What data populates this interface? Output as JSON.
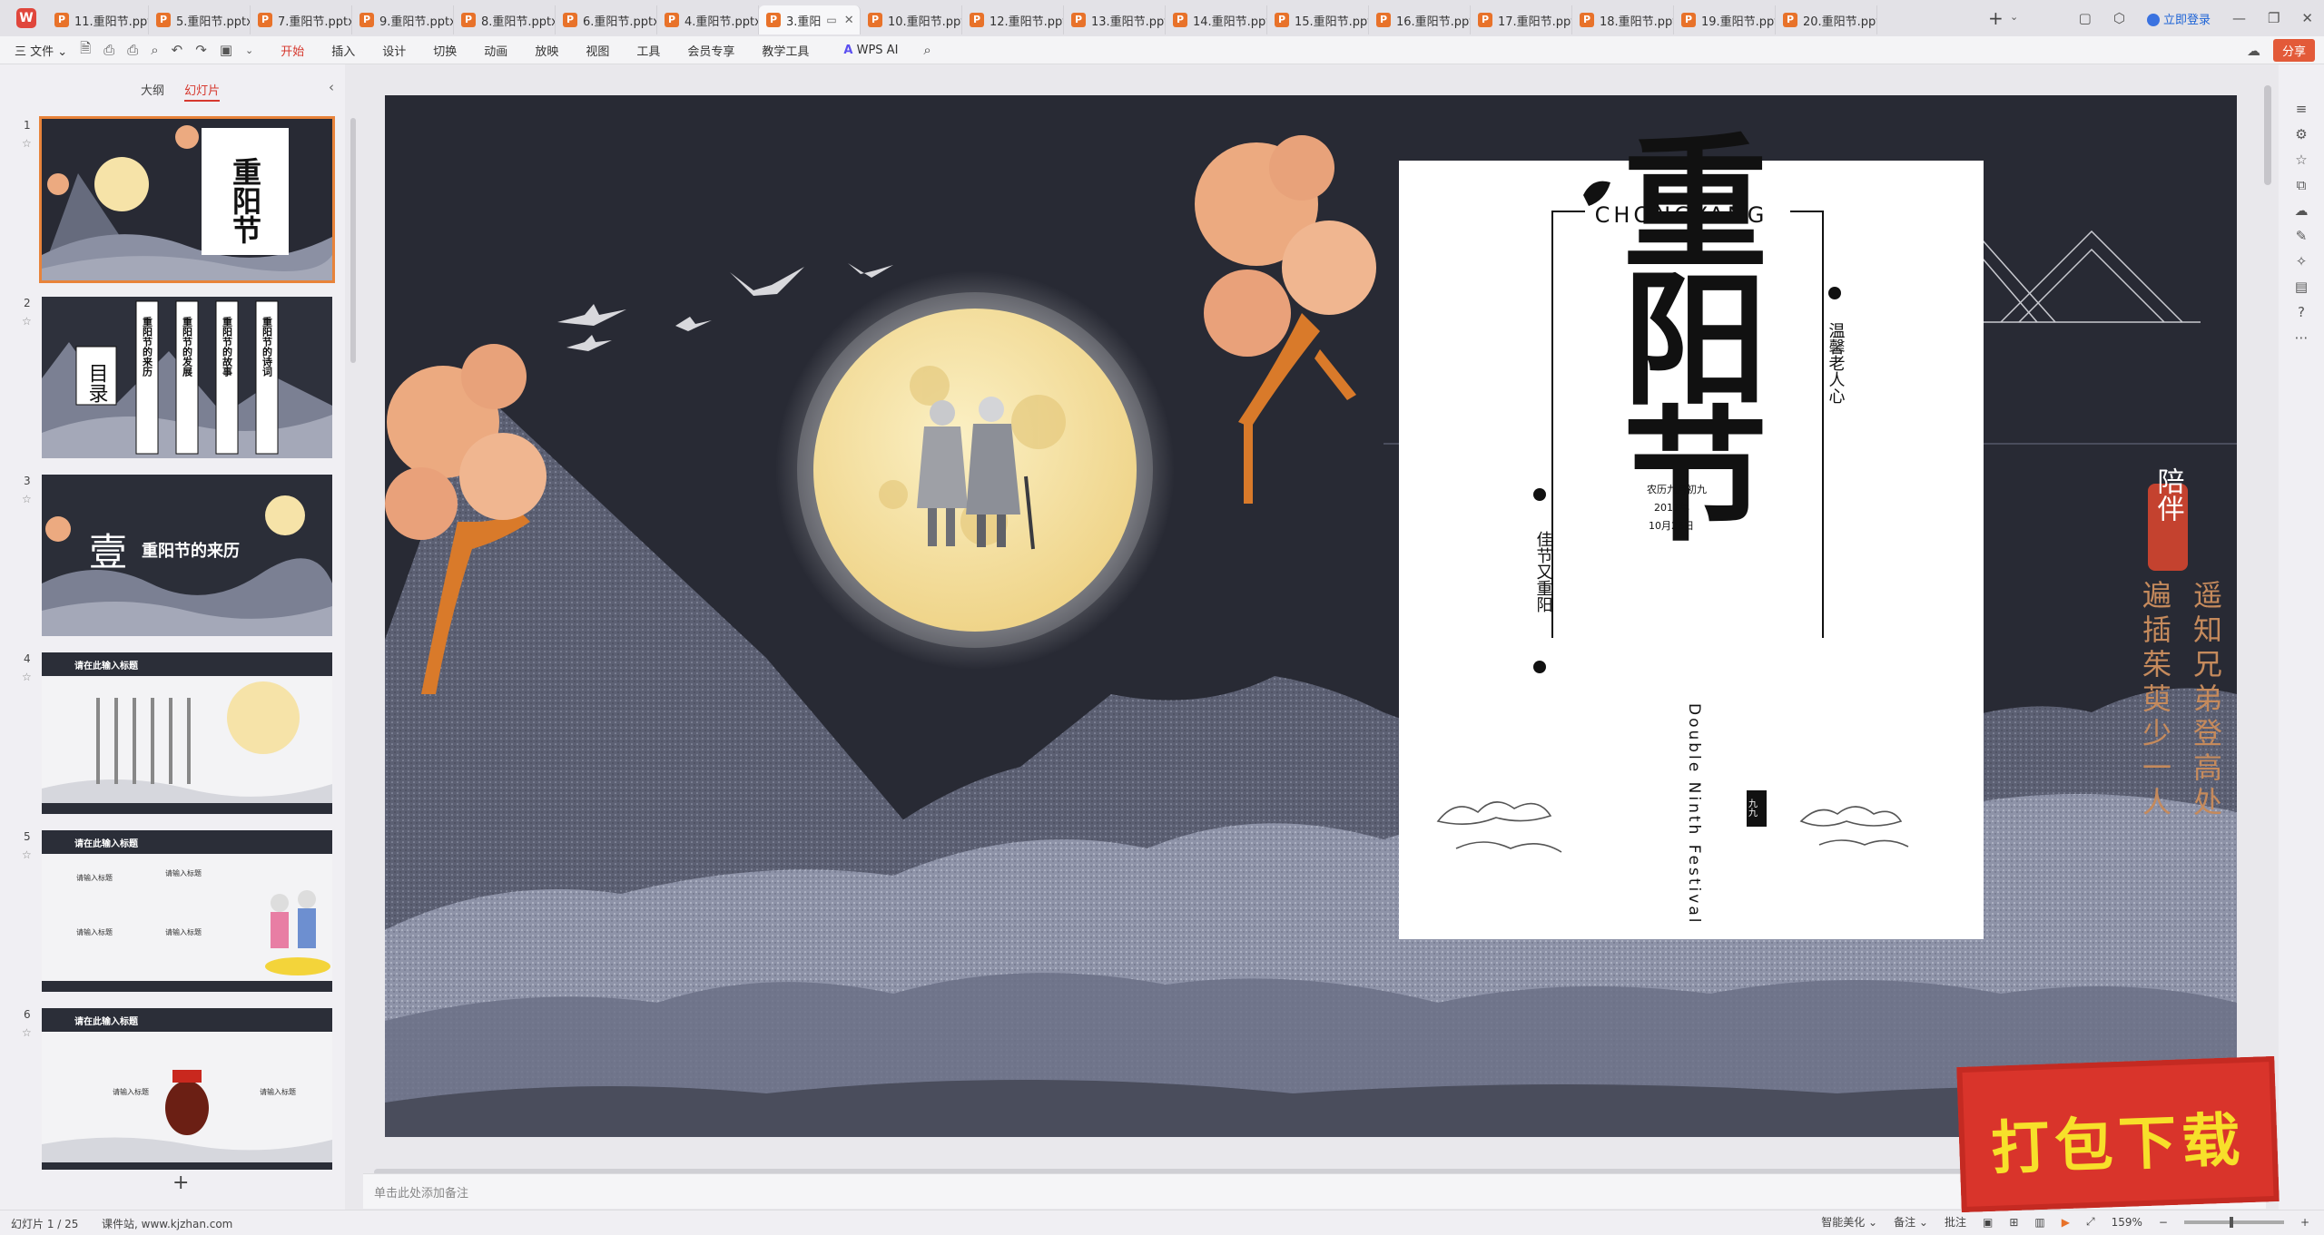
{
  "app": {
    "logo": "W"
  },
  "tabs": [
    {
      "label": "11.重阳节.ppt"
    },
    {
      "label": "5.重阳节.pptx"
    },
    {
      "label": "7.重阳节.pptx"
    },
    {
      "label": "9.重阳节.pptx"
    },
    {
      "label": "8.重阳节.pptx"
    },
    {
      "label": "6.重阳节.pptx"
    },
    {
      "label": "4.重阳节.pptx"
    },
    {
      "label": "3.重阳",
      "active": true
    },
    {
      "label": "10.重阳节.ppt"
    },
    {
      "label": "12.重阳节.ppt"
    },
    {
      "label": "13.重阳节.ppt"
    },
    {
      "label": "14.重阳节.ppt"
    },
    {
      "label": "15.重阳节.ppt"
    },
    {
      "label": "16.重阳节.ppt"
    },
    {
      "label": "17.重阳节.ppt"
    },
    {
      "label": "18.重阳节.ppt"
    },
    {
      "label": "19.重阳节.ppt"
    },
    {
      "label": "20.重阳节.ppt"
    }
  ],
  "titlebar": {
    "login": "立即登录"
  },
  "ribbon": {
    "file": "三 文件 ⌄",
    "menus": [
      "开始",
      "插入",
      "设计",
      "切换",
      "动画",
      "放映",
      "视图",
      "工具",
      "会员专享",
      "教学工具"
    ],
    "active_menu": "开始",
    "wps_ai": "WPS AI",
    "share": "分享"
  },
  "left_panel": {
    "outline_tab": "大纲",
    "slides_tab": "幻灯片",
    "slides": [
      {
        "num": "1",
        "texts": [
          "重阳节"
        ]
      },
      {
        "num": "2",
        "texts": [
          "目录",
          "重阳节的来历",
          "重阳节的发展",
          "重阳节的故事",
          "重阳节的诗词"
        ]
      },
      {
        "num": "3",
        "texts": [
          "壹",
          "重阳节的来历"
        ]
      },
      {
        "num": "4",
        "texts": [
          "请在此输入标题"
        ]
      },
      {
        "num": "5",
        "texts": [
          "请在此输入标题",
          "请输入标题",
          "请输入标题",
          "请输入标题",
          "请输入标题"
        ]
      },
      {
        "num": "6",
        "texts": [
          "请在此输入标题",
          "请输入标题",
          "请输入标题"
        ]
      }
    ],
    "add_slide": "+"
  },
  "slide": {
    "poster": {
      "pinyin": "CHONGYANG",
      "big_title": "重阳节",
      "vertical_1": "温馨老人心",
      "vertical_2": "佳节又重阳",
      "date_lines": [
        "农历九月初九",
        "2017年",
        "10月28日"
      ],
      "english": "Double Ninth Festival",
      "seal": "九九"
    },
    "seal_red": "陪伴",
    "poem_col_1": "遥知兄弟登高处",
    "poem_col_2": "遍插茱萸少一人"
  },
  "notes_placeholder": "单击此处添加备注",
  "status": {
    "slide_indicator": "幻灯片 1 / 25",
    "site": "课件站, www.kjzhan.com",
    "smart": "智能美化 ⌄",
    "notes_btn": "备注 ⌄",
    "comment_btn": "批注",
    "zoom": "159%"
  },
  "download_badge": "打包下载",
  "colors": {
    "accent": "#d6382e",
    "tab_icon": "#e8722a",
    "slide_bg": "#282a34",
    "moon": "#f6e3a8",
    "tree": "#ecaa80",
    "badge": "#d9342b",
    "badge_text": "#f7e02a"
  }
}
